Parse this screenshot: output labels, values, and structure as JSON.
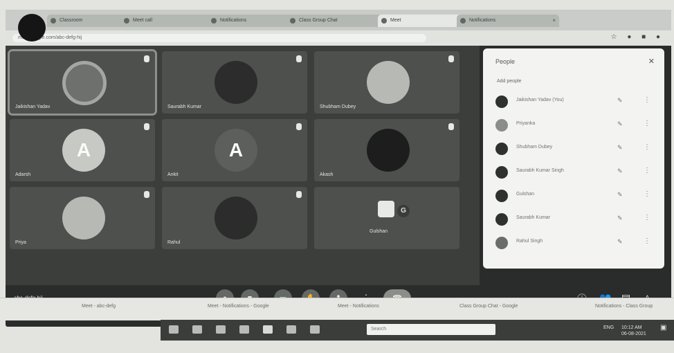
{
  "browser": {
    "tabs": [
      {
        "label": "Classroom"
      },
      {
        "label": "Meet call"
      },
      {
        "label": "Notifications"
      },
      {
        "label": "Class Group Chat"
      },
      {
        "label": "Meet"
      },
      {
        "label": "Notifications"
      }
    ],
    "url": "meet.google.com/abc-defg-hij"
  },
  "tiles": [
    {
      "name": "Jaikishan Yadav",
      "style": "ring",
      "speaking": true
    },
    {
      "name": "Saurabh Kumar",
      "style": "dark"
    },
    {
      "name": "Shubham Dubey",
      "style": "light"
    },
    {
      "name": "Adarsh",
      "style": "letter",
      "letter": "A"
    },
    {
      "name": "Ankit",
      "style": "letter",
      "letter": "A"
    },
    {
      "name": "Akash",
      "style": "dark"
    },
    {
      "name": "Priya",
      "style": "light"
    },
    {
      "name": "Rahul",
      "style": "dark"
    },
    {
      "name": "Gulshan",
      "style": "badge",
      "letter": "G"
    }
  ],
  "controls": {
    "meeting_code": "abc-defg-hij"
  },
  "people": {
    "title": "People",
    "add_people": "Add people",
    "participants": [
      {
        "name": "Jaikishan Yadav (You)"
      },
      {
        "name": "Priyanka"
      },
      {
        "name": "Shubham Dubey"
      },
      {
        "name": "Saurabh Kumar Singh"
      },
      {
        "name": "Gulshan"
      },
      {
        "name": "Saurabh Kumar"
      },
      {
        "name": "Rahul Singh"
      }
    ]
  },
  "taskbar": {
    "items": [
      {
        "label": "Meet - abc-defg"
      },
      {
        "label": "Meet - Notifications - Google"
      },
      {
        "label": "Meet - Notifications"
      },
      {
        "label": "Class Group Chat - Google"
      },
      {
        "label": "Notifications - Class Group"
      }
    ],
    "search_placeholder": "Search",
    "time": "10:12 AM",
    "date": "06-08-2021",
    "lang": "ENG"
  }
}
